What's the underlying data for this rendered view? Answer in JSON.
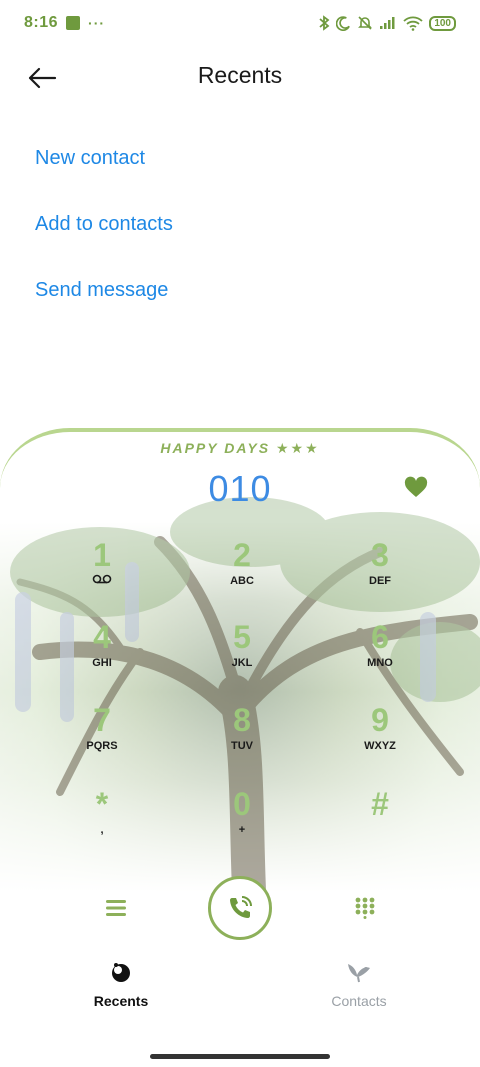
{
  "status_bar": {
    "time": "8:16",
    "dots": "···",
    "battery": "100",
    "color": "#6f9a3e"
  },
  "header": {
    "title": "Recents"
  },
  "actions": {
    "new_contact": "New contact",
    "add_to_contacts": "Add to contacts",
    "send_message": "Send message"
  },
  "dialer": {
    "banner": "HAPPY DAYS ★★★",
    "dialed_number": "010",
    "keys": [
      {
        "digit": "1",
        "letters": "ᴑᴑ"
      },
      {
        "digit": "2",
        "letters": "ABC"
      },
      {
        "digit": "3",
        "letters": "DEF"
      },
      {
        "digit": "4",
        "letters": "GHI"
      },
      {
        "digit": "5",
        "letters": "JKL"
      },
      {
        "digit": "6",
        "letters": "MNO"
      },
      {
        "digit": "7",
        "letters": "PQRS"
      },
      {
        "digit": "8",
        "letters": "TUV"
      },
      {
        "digit": "9",
        "letters": "WXYZ"
      },
      {
        "digit": "*",
        "letters": ","
      },
      {
        "digit": "0",
        "letters": "+"
      },
      {
        "digit": "#",
        "letters": ""
      }
    ],
    "accent_color": "#8db05a",
    "number_color": "#3d8be3"
  },
  "tabs": {
    "recents": "Recents",
    "contacts": "Contacts"
  },
  "link_color": "#1e88e5"
}
